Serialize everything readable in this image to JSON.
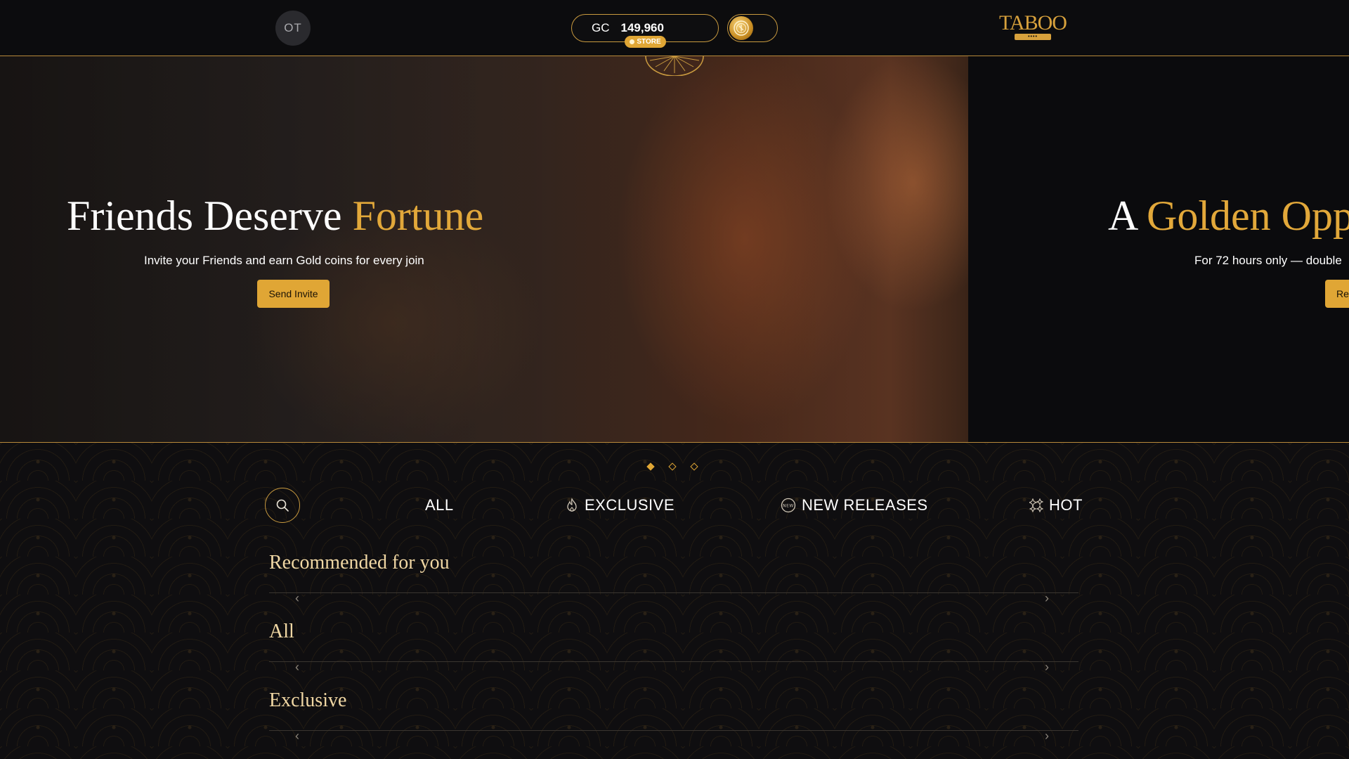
{
  "header": {
    "avatar_initials": "OT",
    "currency": "GC",
    "balance": "149,960",
    "store_label": "STORE",
    "logo_text": "TABOO",
    "logo_sub": "••••"
  },
  "hero": {
    "slides": [
      {
        "title_main": "Friends Deserve",
        "title_accent": "Fortune",
        "subtitle": "Invite your Friends and earn Gold coins for every join",
        "button": "Send Invite"
      },
      {
        "title_main": "A",
        "title_accent": "Golden Opp",
        "subtitle": "For 72 hours only — double",
        "button": "Re"
      }
    ],
    "active_slide": 1,
    "slide_count": 3
  },
  "tabs": [
    {
      "label": "ALL",
      "icon": ""
    },
    {
      "label": "EXCLUSIVE",
      "icon": "flame-icon"
    },
    {
      "label": "NEW RELEASES",
      "icon": "new-badge-icon"
    },
    {
      "label": "HOT",
      "icon": "sparkle-icon"
    }
  ],
  "sections": [
    {
      "title": "Recommended for you"
    },
    {
      "title": "All"
    },
    {
      "title": "Exclusive"
    }
  ],
  "colors": {
    "accent_gold": "#e0a635",
    "background": "#0b0b0d",
    "section_title": "#f0d7a4"
  }
}
